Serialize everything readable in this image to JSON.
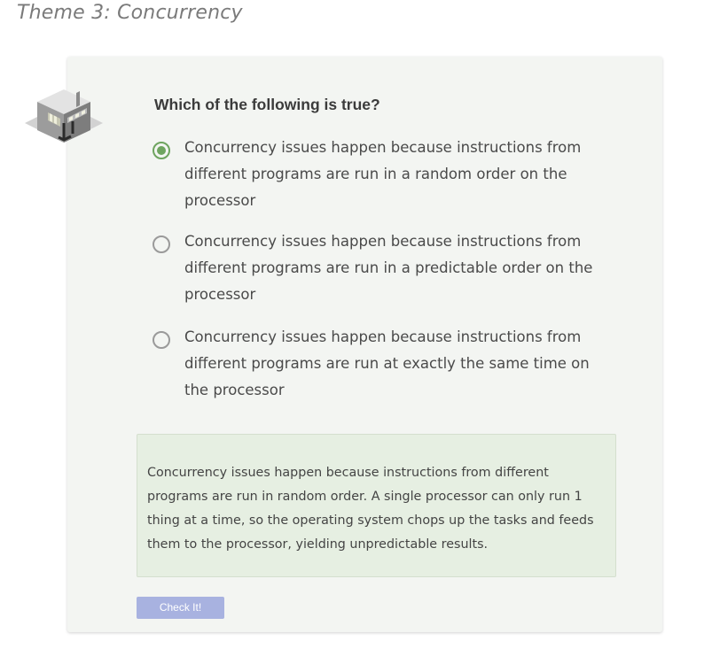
{
  "theme": {
    "title": "Theme 3: Concurrency"
  },
  "quiz": {
    "icon": "server-room-icon",
    "question": "Which of the following is true?",
    "options": [
      {
        "text": "Concurrency issues happen because instructions from different programs are run in a random order on the processor",
        "selected": true
      },
      {
        "text": "Concurrency issues happen because instructions from different programs are run in a predictable order on the processor",
        "selected": false
      },
      {
        "text": "Concurrency issues happen because instructions from different programs are run at exactly the same time on the processor",
        "selected": false
      }
    ],
    "feedback": "Concurrency issues happen because instructions from different programs are run in random order. A single processor can only run 1 thing at a time, so the operating system chops up the tasks and feeds them to the processor, yielding unpredictable results.",
    "check_label": "Check It!"
  },
  "colors": {
    "selected_radio": "#6ea45f",
    "button_bg": "#a8b2e0",
    "card_bg": "#f3f5f2",
    "feedback_bg": "#e6efe2"
  }
}
